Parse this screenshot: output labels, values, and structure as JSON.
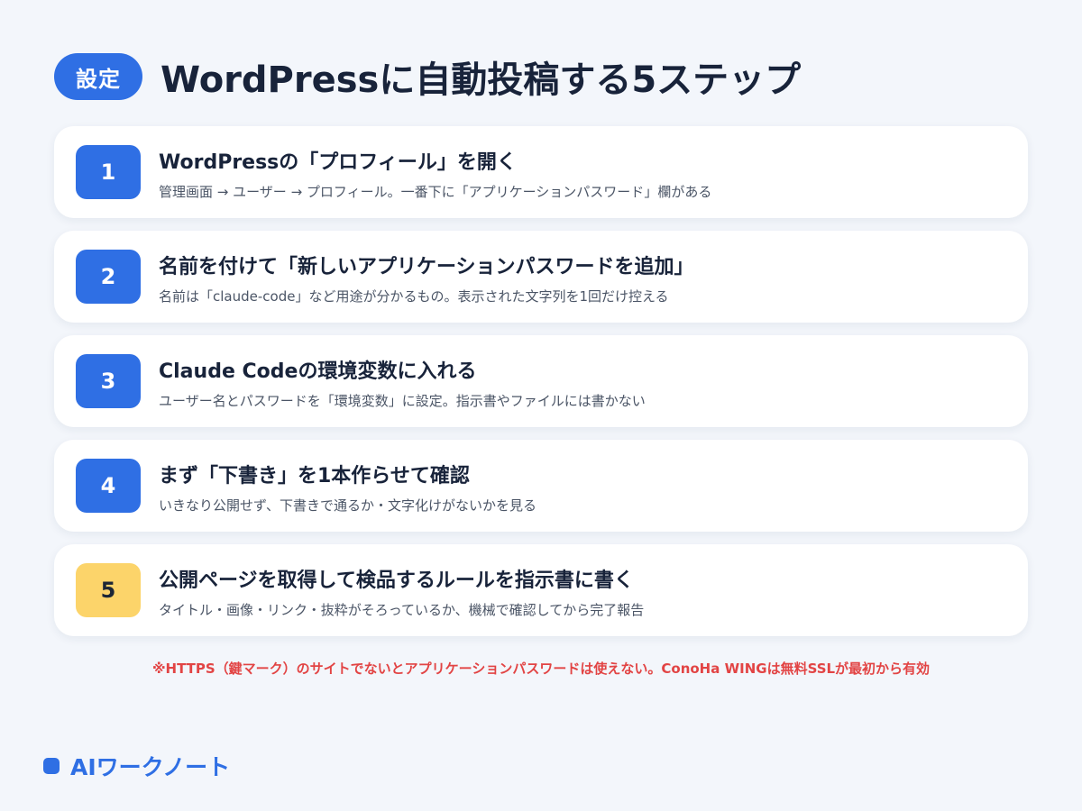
{
  "header": {
    "badge": "設定",
    "title": "WordPressに自動投稿する5ステップ"
  },
  "steps": [
    {
      "number": "1",
      "title": "WordPressの「プロフィール」を開く",
      "description": "管理画面 → ユーザー → プロフィール。一番下に「アプリケーションパスワード」欄がある"
    },
    {
      "number": "2",
      "title": "名前を付けて「新しいアプリケーションパスワードを追加」",
      "description": "名前は「claude-code」など用途が分かるもの。表示された文字列を1回だけ控える"
    },
    {
      "number": "3",
      "title": "Claude Codeの環境変数に入れる",
      "description": "ユーザー名とパスワードを「環境変数」に設定。指示書やファイルには書かない"
    },
    {
      "number": "4",
      "title": "まず「下書き」を1本作らせて確認",
      "description": "いきなり公開せず、下書きで通るか・文字化けがないかを見る"
    },
    {
      "number": "5",
      "title": "公開ページを取得して検品するルールを指示書に書く",
      "description": "タイトル・画像・リンク・抜粋がそろっているか、機械で確認してから完了報告"
    }
  ],
  "footnote": "※HTTPS（鍵マーク）のサイトでないとアプリケーションパスワードは使えない。ConoHa WINGは無料SSLが最初から有効",
  "brand": {
    "name": "AIワークノート"
  },
  "colors": {
    "accent": "#2f6fe4",
    "highlight": "#fcd46a",
    "warning": "#e24444",
    "background": "#f3f6fb"
  }
}
